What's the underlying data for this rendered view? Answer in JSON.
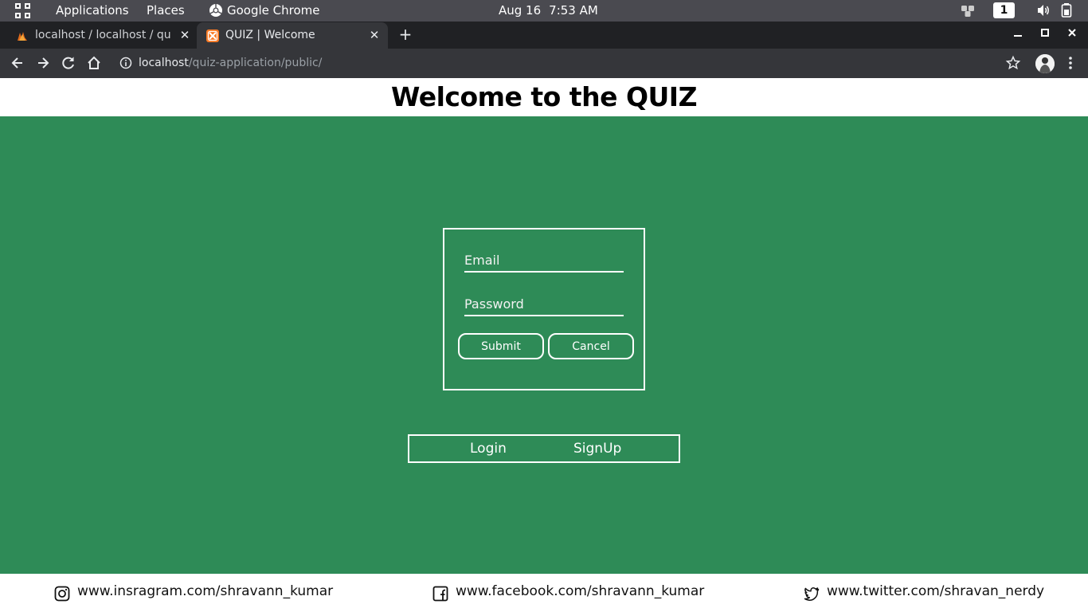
{
  "topbar": {
    "applications": "Applications",
    "places": "Places",
    "active_app": "Google Chrome",
    "date": "Aug 16",
    "time": "7:53 AM",
    "workspace": "1"
  },
  "browser": {
    "tabs": [
      {
        "title": "localhost / localhost / quiz",
        "active": false,
        "favicon": "phpmyadmin-icon"
      },
      {
        "title": "QUIZ | Welcome",
        "active": true,
        "favicon": "xampp-icon"
      }
    ],
    "url_host": "localhost",
    "url_path": "/quiz-application/public/"
  },
  "page": {
    "title": "Welcome to the QUIZ",
    "form": {
      "email_placeholder": "Email",
      "password_placeholder": "Password",
      "submit_label": "Submit",
      "cancel_label": "Cancel"
    },
    "nav": {
      "login": "Login",
      "signup": "SignUp"
    },
    "footer": {
      "instagram": "www.insragram.com/shravann_kumar",
      "facebook": "www.facebook.com/shravann_kumar",
      "twitter": "www.twitter.com/shravan_nerdy"
    }
  },
  "colors": {
    "page_bg": "#2e8b57",
    "header_bg": "#ffffff",
    "chrome_dark": "#202124",
    "chrome_toolbar": "#35363a"
  }
}
